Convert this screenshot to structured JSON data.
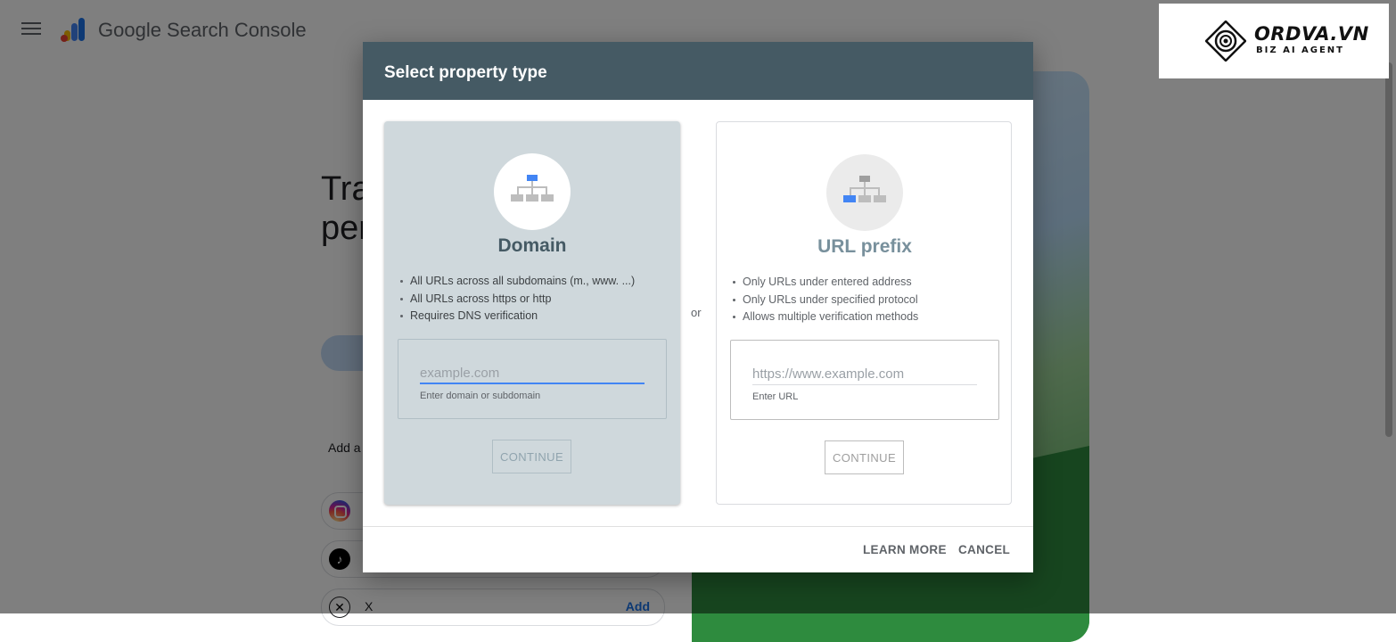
{
  "app": {
    "title": "Google Search Console"
  },
  "background": {
    "heading_line1": "Tra",
    "heading_line2": "per",
    "add_account_text": "Add a",
    "social": [
      {
        "icon": "instagram-icon",
        "label": ""
      },
      {
        "icon": "tiktok-icon",
        "label": ""
      },
      {
        "icon": "x-icon",
        "label": "X",
        "action": "Add"
      }
    ]
  },
  "brand": {
    "name": "ORDVA.VN",
    "tagline": "BIZ AI AGENT"
  },
  "dialog": {
    "title": "Select property type",
    "or_label": "or",
    "domain": {
      "heading": "Domain",
      "features": [
        "All URLs across all subdomains (m., www. ...)",
        "All URLs across https or http",
        "Requires DNS verification"
      ],
      "input_value": "",
      "input_placeholder": "example.com",
      "input_hint": "Enter domain or subdomain",
      "continue_label": "CONTINUE",
      "accent_color": "#4285f4"
    },
    "url_prefix": {
      "heading": "URL prefix",
      "features": [
        "Only URLs under entered address",
        "Only URLs under specified protocol",
        "Allows multiple verification methods"
      ],
      "input_value": "",
      "input_placeholder": "https://www.example.com",
      "input_hint": "Enter URL",
      "continue_label": "CONTINUE"
    },
    "footer": {
      "learn_more_label": "LEARN MORE",
      "cancel_label": "CANCEL"
    },
    "header_color": "#455a64"
  }
}
